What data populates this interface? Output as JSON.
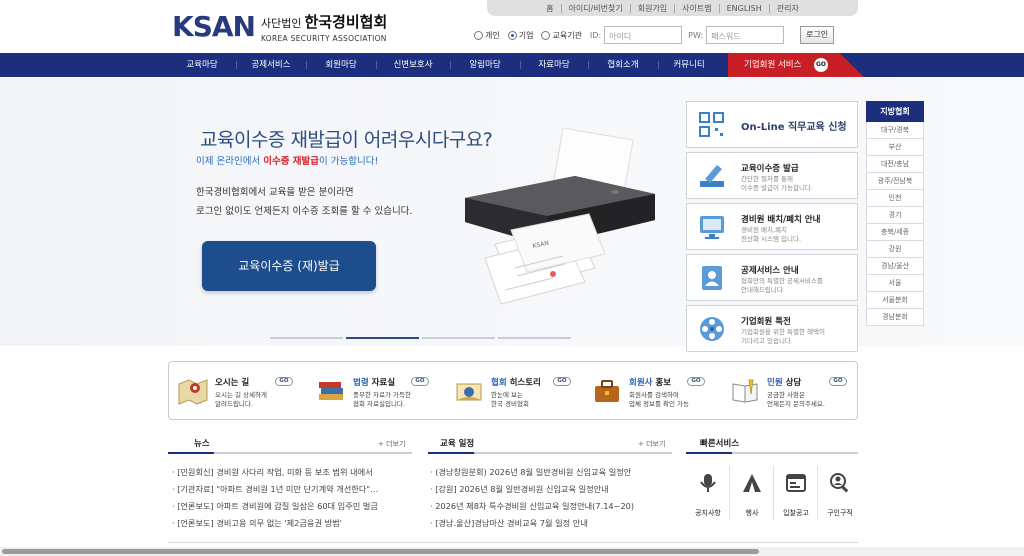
{
  "util_links": [
    "홈",
    "아이디/비번찾기",
    "회원가입",
    "사이트맵",
    "ENGLISH",
    "관리자"
  ],
  "logo": {
    "mark": "KSAN",
    "prefix": "사단법인",
    "name": "한국경비협회",
    "english": "KOREA SECURITY ASSOCIATION"
  },
  "login": {
    "types": [
      {
        "label": "개인",
        "selected": false
      },
      {
        "label": "기업",
        "selected": true
      },
      {
        "label": "교육기관",
        "selected": false
      }
    ],
    "id_label": "ID:",
    "id_placeholder": "아이디",
    "pw_label": "PW:",
    "pw_placeholder": "패스워드",
    "button": "로그인"
  },
  "nav": {
    "items": [
      "교육마당",
      "공제서비스",
      "회원마당",
      "신변보호사",
      "알림마당",
      "자료마당",
      "협회소개",
      "커뮤니티"
    ],
    "corp_label": "기업회원 서비스",
    "corp_go": "GO"
  },
  "hero": {
    "title": "교육이수증 재발급이 어려우시다구요?",
    "sub_prefix": "이제 온라인에서 ",
    "sub_highlight": "이수증 재발급",
    "sub_suffix": "이 가능합니다!",
    "desc_line1": "한국경비협회에서 교육을 받은 분이라면",
    "desc_line2": "로그인 없이도 언제든지 이수증 조회를 할 수 있습니다.",
    "button": "교육이수증 (재)발급",
    "printer_brand": "KSAN"
  },
  "quick_cards": [
    {
      "title": "On-Line 직무교육 신청",
      "desc1": "",
      "desc2": "",
      "icon": "qr-code-icon"
    },
    {
      "title": "교육이수증 발급",
      "desc1": "간단한 절차를 통해",
      "desc2": "이수증 발급이 가능합니다.",
      "icon": "pencil-certificate-icon"
    },
    {
      "title": "경비원 배치/폐치 안내",
      "desc1": "경비원 배치,폐치",
      "desc2": "전산화 시스템 입니다.",
      "icon": "monitor-icon"
    },
    {
      "title": "공제서비스 안내",
      "desc1": "협회만의 특별한 공제서비스를",
      "desc2": "안내해드립니다.",
      "icon": "contact-book-icon"
    },
    {
      "title": "기업회원 특전",
      "desc1": "기업회원을 위한 특별한 혜택이",
      "desc2": "기다리고 있습니다.",
      "icon": "film-reel-icon"
    }
  ],
  "region": {
    "title": "지방협회",
    "items": [
      "대구/경북",
      "부산",
      "대전/충남",
      "광주/전남북",
      "인천",
      "경기",
      "충북/세종",
      "강원",
      "경남/울산",
      "서울",
      "서울분회",
      "경남분회"
    ]
  },
  "shortcuts": [
    {
      "title_a": "오시는 길",
      "title_b": "",
      "desc1": "오시는 길 상세하게",
      "desc2": "알려드립니다.",
      "go": "GO",
      "icon": "map-icon"
    },
    {
      "title_a": "법령",
      "title_b": " 자료실",
      "desc1": "풍부한 자료가 가득한",
      "desc2": "협회 자료실입니다.",
      "go": "GO",
      "icon": "books-icon"
    },
    {
      "title_a": "협회",
      "title_b": " 히스토리",
      "desc1": "한눈에 보는",
      "desc2": "한국 경비협회",
      "go": "GO",
      "icon": "history-icon"
    },
    {
      "title_a": "회원사",
      "title_b": " 홍보",
      "desc1": "회원사를 검색하여",
      "desc2": "업체 정보를 확인 가능",
      "go": "GO",
      "icon": "briefcase-icon"
    },
    {
      "title_a": "민원",
      "title_b": " 상담",
      "desc1": "궁금한 사항은",
      "desc2": "언제든지 문의주세요.",
      "go": "GO",
      "icon": "book-pencil-icon"
    }
  ],
  "news": {
    "title": "뉴스",
    "more": "+ 더보기",
    "items": [
      "· [민원회신] 경비원 사다리 작업, 미화 등 보조 범위 내에서",
      "· [기관자료] \"아파트 경비원 1년 미만 단기계약 개선한다\"…",
      "· [언론보도] 아파트 경비원에 갑질 일삼은 60대 입주민 벌금",
      "· [언론보도] 경비고용 의무 없는 '제2금융권 방범'"
    ]
  },
  "schedule": {
    "title": "교육 일정",
    "more": "+ 더보기",
    "items": [
      "· (경남창원분회) 2026년 8월 일반경비원 신임교육 일정안",
      "· [강원] 2026년 8월 일반경비원 신임교육 일정안내",
      "· 2026년 제8차 특수경비원 신임교육 일정안내(7.14~20)",
      "· [경남.울산]경남마산 경비교육 7월 일정 안내"
    ]
  },
  "services": {
    "title": "빠른서비스",
    "items": [
      {
        "label": "공지사항",
        "icon": "microphone-icon"
      },
      {
        "label": "행사",
        "icon": "event-tent-icon"
      },
      {
        "label": "입찰공고",
        "icon": "browser-window-icon"
      },
      {
        "label": "구인구직",
        "icon": "magnifier-person-icon"
      }
    ]
  },
  "colors": {
    "nav": "#1c2f7e",
    "corp": "#c81f27",
    "hero_button": "#1d4d8c",
    "accent_blue": "#2b6fc1",
    "accent_red": "#d3232a"
  }
}
